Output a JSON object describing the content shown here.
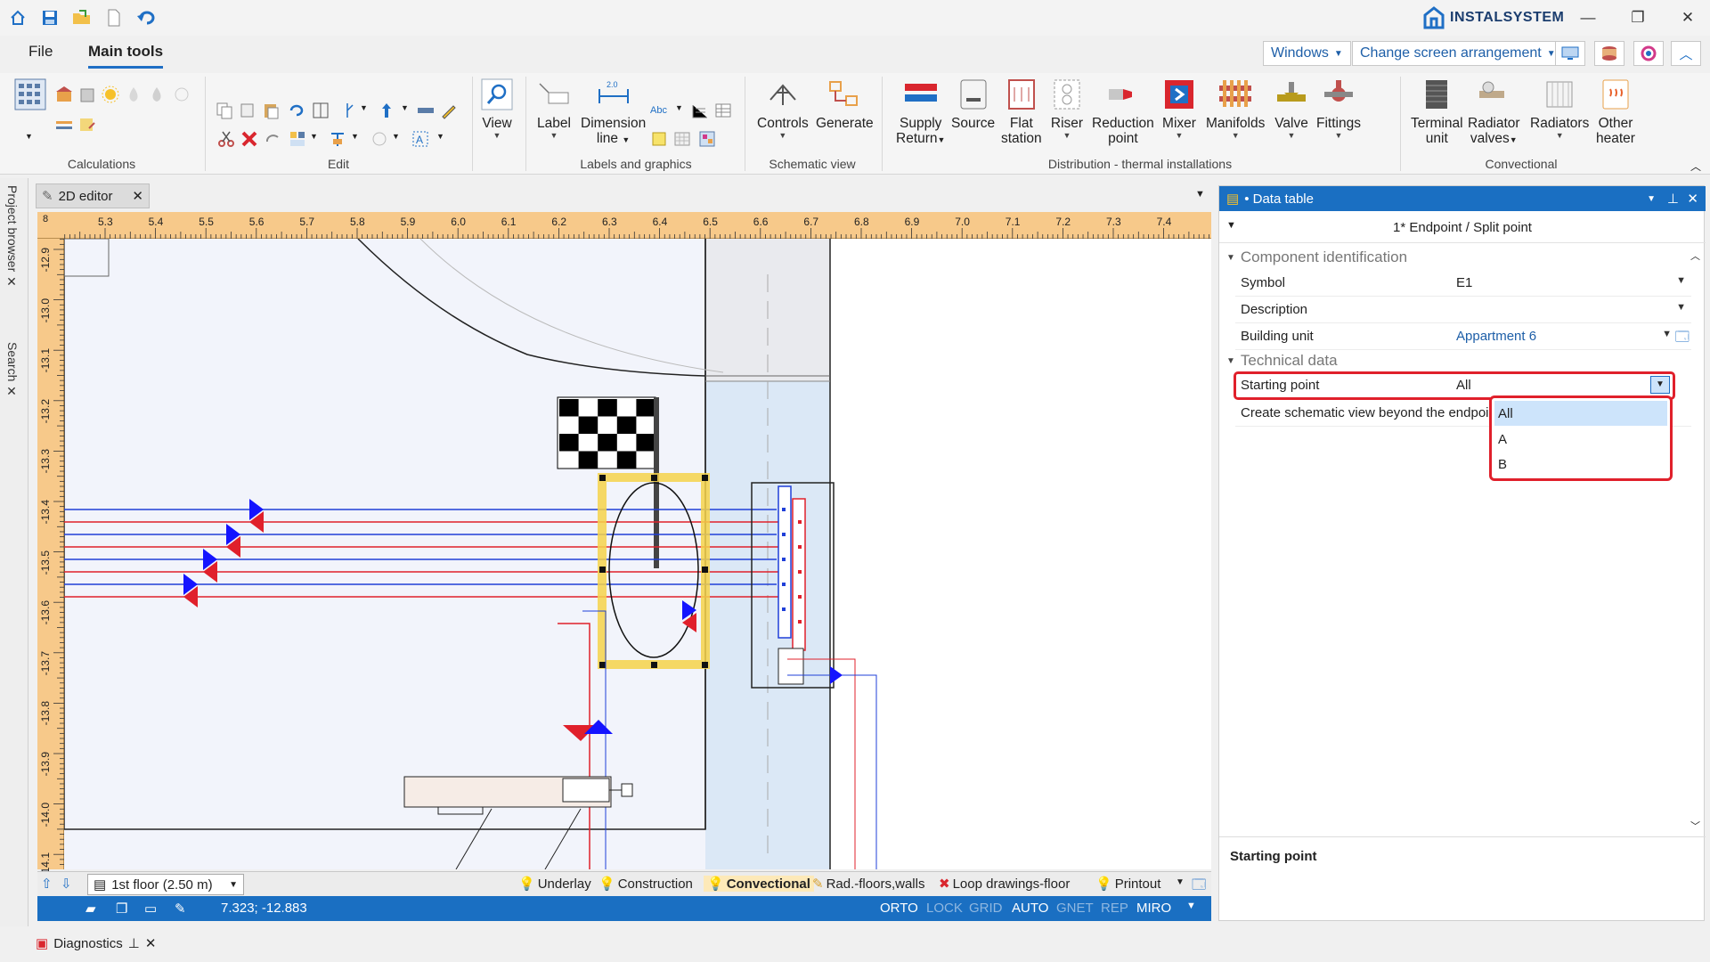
{
  "app": {
    "brand": "INSTALSYSTEM",
    "windows_btn": "Windows",
    "arrangement_btn": "Change screen arrangement"
  },
  "tabs": [
    "File",
    "Main tools"
  ],
  "ribbon": {
    "groups": [
      "Calculations",
      "Edit",
      "Labels and graphics",
      "Schematic view",
      "Distribution - thermal installations",
      "Convectional"
    ],
    "view": "View",
    "label": "Label",
    "dimension": [
      "Dimension",
      "line"
    ],
    "controls": "Controls",
    "generate": "Generate",
    "supply": [
      "Supply",
      "Return"
    ],
    "source": "Source",
    "flat": [
      "Flat",
      "station"
    ],
    "riser": "Riser",
    "reduction": [
      "Reduction",
      "point"
    ],
    "mixer": "Mixer",
    "manifolds": "Manifolds",
    "valve": "Valve",
    "fittings": "Fittings",
    "terminal": [
      "Terminal",
      "unit"
    ],
    "radvalves": [
      "Radiator",
      "valves"
    ],
    "radiators": "Radiators",
    "other": [
      "Other",
      "heater"
    ],
    "small_text": "Abc",
    "dim_value": "2.0"
  },
  "left_tabs": [
    "Project browser",
    "Search"
  ],
  "editor": {
    "tab_title": "2D editor",
    "ruler_x": [
      "5.3",
      "5.4",
      "5.5",
      "5.6",
      "5.7",
      "5.8",
      "5.9",
      "6.0",
      "6.1",
      "6.2",
      "6.3",
      "6.4",
      "6.5",
      "6.6",
      "6.7",
      "6.8",
      "6.9",
      "7.0",
      "7.1",
      "7.2",
      "7.3",
      "7.4"
    ],
    "ruler_y": [
      "-12.9",
      "-13.0",
      "-13.1",
      "-13.2",
      "-13.3",
      "-13.4",
      "-13.5",
      "-13.6",
      "-13.7",
      "-13.8",
      "-13.9",
      "-14.0",
      "-14.1"
    ],
    "corner_label": "8",
    "floor": "1st floor (2.50 m)",
    "layers": [
      "Underlay",
      "Construction",
      "Convectional",
      "Rad.-floors,walls",
      "Loop drawings-floor",
      "Printout"
    ],
    "active_layer": "Convectional",
    "coords": "7.323; -12.883",
    "modes": [
      "ORTO",
      "LOCK",
      "GRID",
      "AUTO",
      "GNET",
      "REP",
      "MIRO"
    ],
    "modes_active": [
      true,
      false,
      false,
      true,
      false,
      false,
      true
    ]
  },
  "diagnostics": "Diagnostics",
  "panel": {
    "title": "• Data table",
    "subtitle": "1* Endpoint / Split point",
    "sections": [
      "Component identification",
      "Technical data"
    ],
    "rows": [
      {
        "key": "Symbol",
        "value": "E1"
      },
      {
        "key": "Description",
        "value": ""
      },
      {
        "key": "Building unit",
        "value": "Appartment 6"
      },
      {
        "key": "Starting point",
        "value": "All"
      },
      {
        "key": "Create schematic view beyond the endpoint",
        "value": ""
      }
    ],
    "dropdown_options": [
      "All",
      "A",
      "B"
    ],
    "selected_option": "All",
    "desc_title": "Starting point"
  }
}
